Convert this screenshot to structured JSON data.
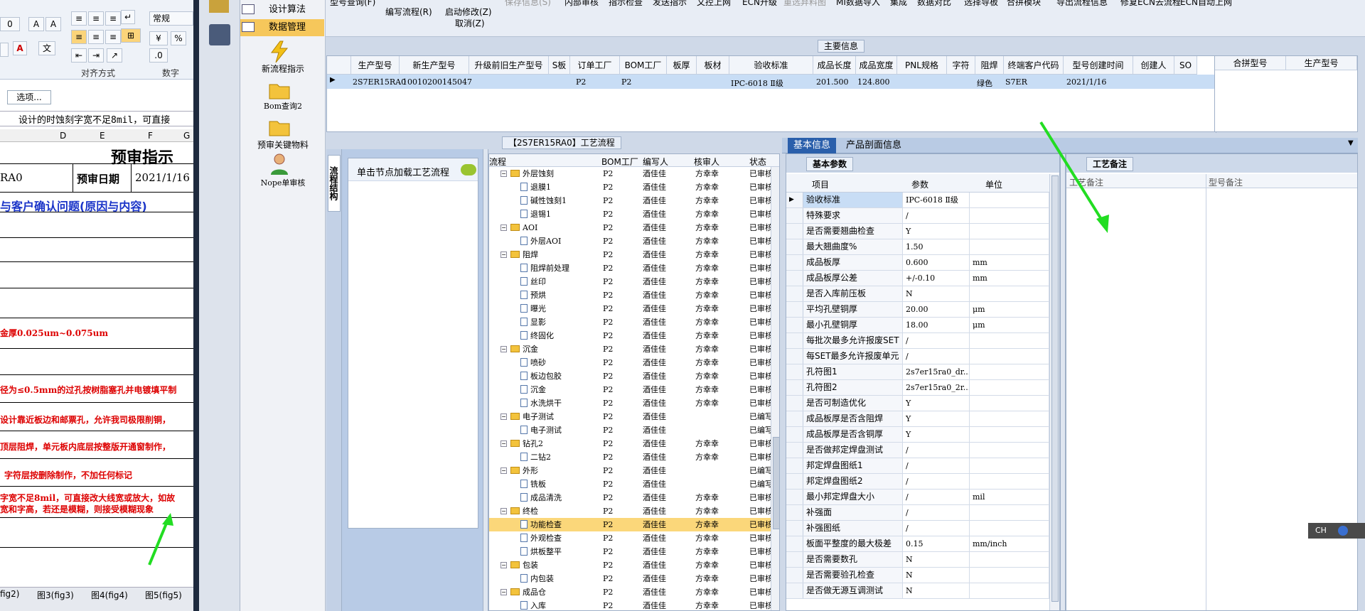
{
  "excel": {
    "font_name": "常规",
    "percent": "%",
    "group_align": "对齐方式",
    "group_number": "数字",
    "options_btn": "选项...",
    "formula": "设计的时蚀刻字宽不足8mil，可直接",
    "cols": [
      "D",
      "E",
      "F",
      "G"
    ],
    "title": "预审指示",
    "rao": "RA0",
    "date_label": "预审日期",
    "date_value": "2021/1/16",
    "confirm": "与客户确认问题(原因与内容)",
    "rows": [
      "金厚0.025um~0.075um",
      "径为≤0.5mm的过孔按树脂塞孔并电镀填平制",
      "设计靠近板边和邮票孔，允许我司极限削铜，",
      "顶层阻焊，单元板内底层按整版开通窗制作，",
      "字符层按删除制作，不加任何标记",
      "字宽不足8mil，可直接改大线宽或放大，如故",
      "宽和字高，若还是模糊，则接受模糊现象"
    ],
    "sheet_tabs": [
      "fig2)",
      "图3(fig3)",
      "图4(fig4)",
      "图5(fig5)"
    ]
  },
  "nav_menu": {
    "items": [
      "设计算法",
      "数据管理"
    ],
    "icons": [
      {
        "label": "新流程指示"
      },
      {
        "label": "Bom查询2"
      },
      {
        "label": "预审关键物料"
      },
      {
        "label": "Nope单审核"
      }
    ]
  },
  "toolbar": {
    "buttons": [
      "型号查询(F)",
      "编写流程(R)",
      "启动修改(Z)",
      "取消(Z)",
      "保存信息(S)",
      "内部审核",
      "指示检查",
      "发送指示",
      "文控上网",
      "ECN升级",
      "重选弃料图",
      "MI数据导入",
      "集成",
      "数据对比",
      "选择导板",
      "合拼模块",
      "导出流程信息",
      "修复ECN去流程",
      "ECN自动上网"
    ]
  },
  "main_info": {
    "title": "主要信息",
    "headers": [
      "生产型号",
      "新生产型号",
      "升级前旧生产型号",
      "S板",
      "订单工厂",
      "BOM工厂",
      "板厚",
      "板材",
      "验收标准",
      "成品长度",
      "成品宽度",
      "PNL规格",
      "字符",
      "阻焊",
      "终端客户代码",
      "型号创建时间",
      "创建人",
      "SO"
    ],
    "row": {
      "model": "2S7ER15RA0",
      "new_model": "10010200145047",
      "order_factory": "P2",
      "bom_factory": "P2",
      "standard": "IPC-6018 Ⅱ级",
      "length": "201.500",
      "width": "124.800",
      "solder": "绿色",
      "customer": "S7ER",
      "created": "2021/1/16"
    },
    "merge_headers": [
      "合拼型号",
      "生产型号"
    ]
  },
  "process": {
    "title": "【2S7ER15RA0】工艺流程",
    "side_tab": "流程结构",
    "click_hint": "单击节点加载工艺流程",
    "headers": [
      "流程",
      "BOM工厂",
      "编写人",
      "核审人",
      "状态"
    ],
    "rows": [
      {
        "name": "外层蚀刻",
        "level": 0,
        "bom": "P2",
        "writer": "酒佳佳",
        "reviewer": "方幸幸",
        "status": "已审核"
      },
      {
        "name": "退膜1",
        "level": 1,
        "bom": "P2",
        "writer": "酒佳佳",
        "reviewer": "方幸幸",
        "status": "已审核"
      },
      {
        "name": "碱性蚀刻1",
        "level": 1,
        "bom": "P2",
        "writer": "酒佳佳",
        "reviewer": "方幸幸",
        "status": "已审核"
      },
      {
        "name": "退锡1",
        "level": 1,
        "bom": "P2",
        "writer": "酒佳佳",
        "reviewer": "方幸幸",
        "status": "已审核"
      },
      {
        "name": "AOI",
        "level": 0,
        "bom": "P2",
        "writer": "酒佳佳",
        "reviewer": "方幸幸",
        "status": "已审核"
      },
      {
        "name": "外层AOI",
        "level": 1,
        "bom": "P2",
        "writer": "酒佳佳",
        "reviewer": "方幸幸",
        "status": "已审核"
      },
      {
        "name": "阻焊",
        "level": 0,
        "bom": "P2",
        "writer": "酒佳佳",
        "reviewer": "方幸幸",
        "status": "已审核"
      },
      {
        "name": "阻焊前处理",
        "level": 1,
        "bom": "P2",
        "writer": "酒佳佳",
        "reviewer": "方幸幸",
        "status": "已审核"
      },
      {
        "name": "丝印",
        "level": 1,
        "bom": "P2",
        "writer": "酒佳佳",
        "reviewer": "方幸幸",
        "status": "已审核"
      },
      {
        "name": "预烘",
        "level": 1,
        "bom": "P2",
        "writer": "酒佳佳",
        "reviewer": "方幸幸",
        "status": "已审核"
      },
      {
        "name": "曝光",
        "level": 1,
        "bom": "P2",
        "writer": "酒佳佳",
        "reviewer": "方幸幸",
        "status": "已审核"
      },
      {
        "name": "显影",
        "level": 1,
        "bom": "P2",
        "writer": "酒佳佳",
        "reviewer": "方幸幸",
        "status": "已审核"
      },
      {
        "name": "终固化",
        "level": 1,
        "bom": "P2",
        "writer": "酒佳佳",
        "reviewer": "方幸幸",
        "status": "已审核"
      },
      {
        "name": "沉金",
        "level": 0,
        "bom": "P2",
        "writer": "酒佳佳",
        "reviewer": "方幸幸",
        "status": "已审核"
      },
      {
        "name": "喷砂",
        "level": 1,
        "bom": "P2",
        "writer": "酒佳佳",
        "reviewer": "方幸幸",
        "status": "已审核"
      },
      {
        "name": "板边包胶",
        "level": 1,
        "bom": "P2",
        "writer": "酒佳佳",
        "reviewer": "方幸幸",
        "status": "已审核"
      },
      {
        "name": "沉金",
        "level": 1,
        "bom": "P2",
        "writer": "酒佳佳",
        "reviewer": "方幸幸",
        "status": "已审核"
      },
      {
        "name": "水洗烘干",
        "level": 1,
        "bom": "P2",
        "writer": "酒佳佳",
        "reviewer": "方幸幸",
        "status": "已审核"
      },
      {
        "name": "电子测试",
        "level": 0,
        "bom": "P2",
        "writer": "酒佳佳",
        "reviewer": "",
        "status": "已编写"
      },
      {
        "name": "电子测试",
        "level": 1,
        "bom": "P2",
        "writer": "酒佳佳",
        "reviewer": "",
        "status": "已编写"
      },
      {
        "name": "钻孔2",
        "level": 0,
        "bom": "P2",
        "writer": "酒佳佳",
        "reviewer": "方幸幸",
        "status": "已审核"
      },
      {
        "name": "二钻2",
        "level": 1,
        "bom": "P2",
        "writer": "酒佳佳",
        "reviewer": "方幸幸",
        "status": "已审核"
      },
      {
        "name": "外形",
        "level": 0,
        "bom": "P2",
        "writer": "酒佳佳",
        "reviewer": "",
        "status": "已编写"
      },
      {
        "name": "铣板",
        "level": 1,
        "bom": "P2",
        "writer": "酒佳佳",
        "reviewer": "",
        "status": "已编写"
      },
      {
        "name": "成品清洗",
        "level": 1,
        "bom": "P2",
        "writer": "酒佳佳",
        "reviewer": "方幸幸",
        "status": "已审核"
      },
      {
        "name": "终检",
        "level": 0,
        "bom": "P2",
        "writer": "酒佳佳",
        "reviewer": "方幸幸",
        "status": "已审核"
      },
      {
        "name": "功能检查",
        "level": 1,
        "bom": "P2",
        "writer": "酒佳佳",
        "reviewer": "方幸幸",
        "status": "已审核",
        "selected": true
      },
      {
        "name": "外观检查",
        "level": 1,
        "bom": "P2",
        "writer": "酒佳佳",
        "reviewer": "方幸幸",
        "status": "已审核"
      },
      {
        "name": "烘板整平",
        "level": 1,
        "bom": "P2",
        "writer": "酒佳佳",
        "reviewer": "方幸幸",
        "status": "已审核"
      },
      {
        "name": "包装",
        "level": 0,
        "bom": "P2",
        "writer": "酒佳佳",
        "reviewer": "方幸幸",
        "status": "已审核"
      },
      {
        "name": "内包装",
        "level": 1,
        "bom": "P2",
        "writer": "酒佳佳",
        "reviewer": "方幸幸",
        "status": "已审核"
      },
      {
        "name": "成品仓",
        "level": 0,
        "bom": "P2",
        "writer": "酒佳佳",
        "reviewer": "方幸幸",
        "status": "已审核"
      },
      {
        "name": "入库",
        "level": 1,
        "bom": "P2",
        "writer": "酒佳佳",
        "reviewer": "方幸幸",
        "status": "已审核"
      }
    ]
  },
  "basic": {
    "tab_basic": "基本信息",
    "tab_profile": "产品剖面信息",
    "subtab": "基本参数",
    "headers": [
      "项目",
      "参数",
      "单位"
    ],
    "rows": [
      [
        "验收标准",
        "IPC-6018 Ⅱ级",
        ""
      ],
      [
        "特殊要求",
        "/",
        ""
      ],
      [
        "是否需要翘曲检查",
        "Y",
        ""
      ],
      [
        "最大翘曲度%",
        "1.50",
        ""
      ],
      [
        "成品板厚",
        "0.600",
        "mm"
      ],
      [
        "成品板厚公差",
        "+/-0.10",
        "mm"
      ],
      [
        "是否入库前压板",
        "N",
        ""
      ],
      [
        "平均孔壁铜厚",
        "20.00",
        "μm"
      ],
      [
        "最小孔壁铜厚",
        "18.00",
        "μm"
      ],
      [
        "每批次最多允许报废SET",
        "/",
        ""
      ],
      [
        "每SET最多允许报废单元",
        "/",
        ""
      ],
      [
        "孔符图1",
        "2s7er15ra0_dr...",
        ""
      ],
      [
        "孔符图2",
        "2s7er15ra0_2r...",
        ""
      ],
      [
        "是否可制造优化",
        "Y",
        ""
      ],
      [
        "成品板厚是否含阻焊",
        "Y",
        ""
      ],
      [
        "成品板厚是否含铜厚",
        "Y",
        ""
      ],
      [
        "是否做邦定焊盘测试",
        "/",
        ""
      ],
      [
        "邦定焊盘图纸1",
        "/",
        ""
      ],
      [
        "邦定焊盘图纸2",
        "/",
        ""
      ],
      [
        "最小邦定焊盘大小",
        "/",
        "mil"
      ],
      [
        "补强面",
        "/",
        ""
      ],
      [
        "补强图纸",
        "/",
        ""
      ],
      [
        "板面平整度的最大极差",
        "0.15",
        "mm/inch"
      ],
      [
        "是否需要数孔",
        "N",
        ""
      ],
      [
        "是否需要验孔检查",
        "N",
        ""
      ],
      [
        "是否做无源互调测试",
        "N",
        ""
      ]
    ]
  },
  "remarks": {
    "tab": "工艺备注",
    "col1": "工艺备注",
    "col2": "型号备注"
  },
  "ime": {
    "label": "CH"
  }
}
